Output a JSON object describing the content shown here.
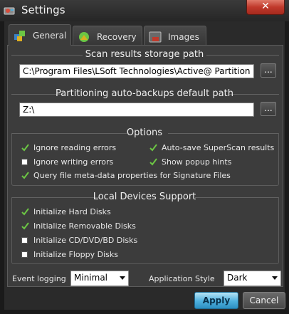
{
  "window": {
    "title": "Settings",
    "close_label": "✕"
  },
  "tabs": [
    {
      "label": "General"
    },
    {
      "label": "Recovery"
    },
    {
      "label": "Images"
    }
  ],
  "scan_results": {
    "heading": "Scan results storage path",
    "value": "C:\\Program Files\\LSoft Technologies\\Active@ Partition Rec",
    "browse_label": "..."
  },
  "auto_backups": {
    "heading": "Partitioning auto-backups default path",
    "value": "Z:\\",
    "browse_label": "..."
  },
  "options": {
    "heading": "Options",
    "items": [
      {
        "label": "Ignore reading errors",
        "checked": true
      },
      {
        "label": "Auto-save SuperScan results",
        "checked": true
      },
      {
        "label": "Ignore writing errors",
        "checked": false
      },
      {
        "label": "Show popup hints",
        "checked": true
      },
      {
        "label": "Query file meta-data properties for Signature Files",
        "checked": true
      }
    ]
  },
  "local_devices": {
    "heading": "Local Devices Support",
    "items": [
      {
        "label": "Initialize Hard Disks",
        "checked": true
      },
      {
        "label": "Initialize Removable Disks",
        "checked": true
      },
      {
        "label": "Initialize CD/DVD/BD Disks",
        "checked": false
      },
      {
        "label": "Initialize Floppy Disks",
        "checked": false
      }
    ]
  },
  "event_logging": {
    "label": "Event logging",
    "value": "Minimal"
  },
  "app_style": {
    "label": "Application Style",
    "value": "Dark"
  },
  "buttons": {
    "apply": "Apply",
    "cancel": "Cancel"
  },
  "colors": {
    "accent": "#4db0de",
    "check": "#6cc644",
    "background": "#3c3c3c"
  }
}
